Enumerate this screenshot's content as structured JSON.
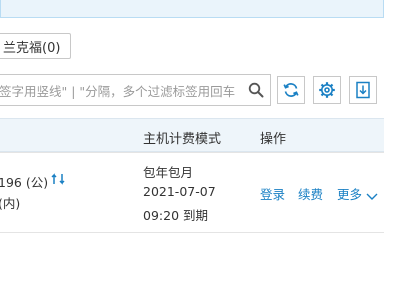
{
  "notice": {},
  "region_tab": {
    "label": "兰克福(0)"
  },
  "search": {
    "placeholder": "签字用竖线\" | \"分隔，多个过滤标签用回车"
  },
  "icons": {
    "search": "search-icon",
    "refresh": "refresh-icon",
    "settings": "gear-icon",
    "download": "download-icon",
    "swap": "swap-icon",
    "chevron": "chevron-down-icon"
  },
  "colors": {
    "link": "#1a80c4",
    "header_bg": "#eef5fa",
    "notice_bg": "#eaf4fb"
  },
  "table": {
    "headers": {
      "billing_mode": "主机计费模式",
      "actions": "操作"
    },
    "row": {
      "ip_public": "196 (公)",
      "ip_private": "(内)",
      "billing_mode": "包年包月",
      "expire_date": "2021-07-07",
      "expire_time": "09:20 到期",
      "action_login": "登录",
      "action_renew": "续费",
      "action_more": "更多"
    }
  }
}
